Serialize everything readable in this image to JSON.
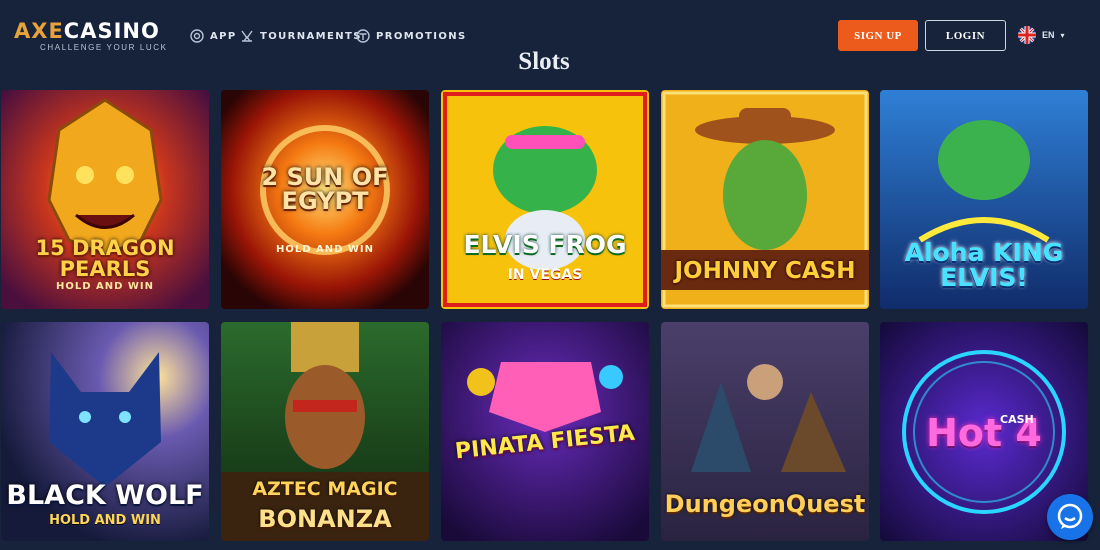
{
  "header": {
    "logo_prefix": "AXE",
    "logo_suffix": "CASINO",
    "logo_tagline": "CHALLENGE YOUR LUCK",
    "nav": [
      {
        "label": "APP",
        "icon": "target-icon"
      },
      {
        "label": "TOURNAMENTS",
        "icon": "trophy-icon"
      },
      {
        "label": "PROMOTIONS",
        "icon": "gift-icon"
      }
    ],
    "signup_label": "SIGN UP",
    "login_label": "LOGIN",
    "language": "EN"
  },
  "section": {
    "title": "Slots"
  },
  "games": [
    {
      "title": "15 DRAGON PEARLS",
      "subtitle": "HOLD AND WIN"
    },
    {
      "title": "2 SUN OF EGYPT",
      "subtitle": "HOLD AND WIN"
    },
    {
      "title": "ELVIS FROG",
      "subtitle": "IN VEGAS"
    },
    {
      "title": "JOHNNY CASH",
      "subtitle": ""
    },
    {
      "title": "Aloha KING ELVIS!",
      "subtitle": ""
    },
    {
      "title": "BLACK WOLF",
      "subtitle": "HOLD AND WIN"
    },
    {
      "title": "AZTEC MAGIC",
      "subtitle": "BONANZA"
    },
    {
      "title": "PINATA FIESTA",
      "subtitle": ""
    },
    {
      "title": "DungeonQuest",
      "subtitle": ""
    },
    {
      "title": "Hot 4",
      "subtitle": "CASH"
    }
  ],
  "colors": {
    "background": "#16233a",
    "signup": "#ec5b1c",
    "accent_gold": "#e8a23b",
    "chat": "#1873e8"
  }
}
